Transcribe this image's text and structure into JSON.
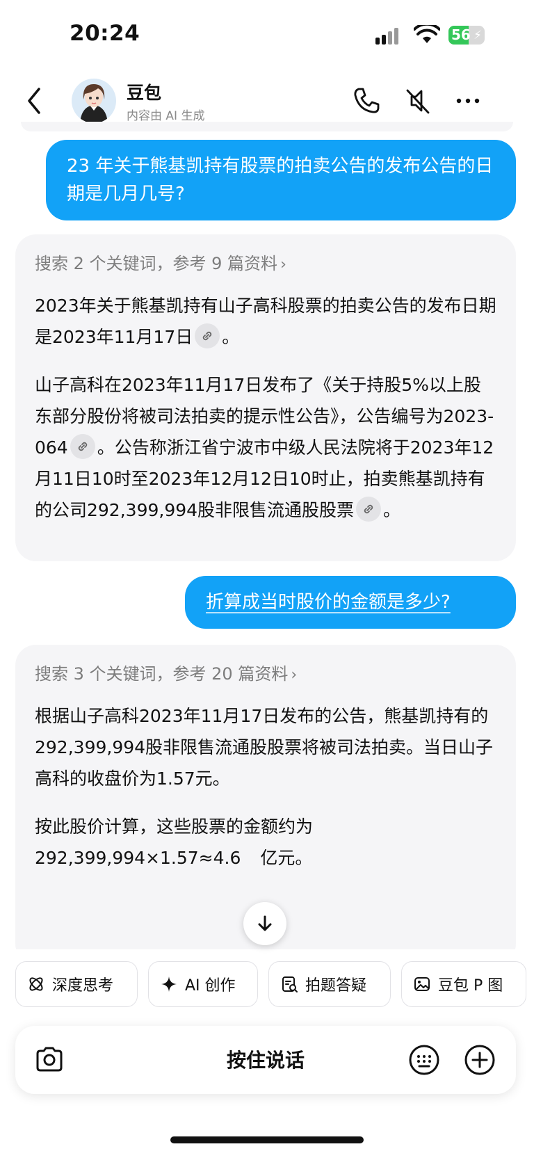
{
  "status_bar": {
    "time": "20:24",
    "battery": "56"
  },
  "header": {
    "name": "豆包",
    "subtitle": "内容由 AI 生成"
  },
  "messages": {
    "user1": "23 年关于熊基凯持有股票的拍卖公告的发布公告的日期是几月几号?",
    "bot1": {
      "search": "搜索 2 个关键词，参考 9 篇资料",
      "p1": "2023年关于熊基凯持有山子高科股票的拍卖公告的发布日期是2023年11月17日",
      "p1_end": "。",
      "p2a": "山子高科在2023年11月17日发布了《关于持股5%以上股东部分股份将被司法拍卖的提示性公告》，公告编号为2023-064",
      "p2b": "。公告称浙江省宁波市中级人民法院将于2023年12月11日10时至2023年12月12日10时止，拍卖熊基凯持有的公司292,399,994股非限售流通股股票",
      "p2_end": "。"
    },
    "user2": "折算成当时股价的金额是多少?",
    "bot2": {
      "search": "搜索 3 个关键词，参考 20 篇资料",
      "p1": "根据山子高科2023年11月17日发布的公告，熊基凯持有的292,399,994股非限售流通股股票将被司法拍卖。当日山子高科的收盘价为1.57元。",
      "p2": "按此股价计算，这些股票的金额约为292,399,994×1.57≈4.6",
      "p2_tail": "亿元。"
    }
  },
  "quick_actions": [
    "深度思考",
    "AI 创作",
    "拍题答疑",
    "豆包 P 图"
  ],
  "input": {
    "hold_to_talk": "按住说话"
  }
}
